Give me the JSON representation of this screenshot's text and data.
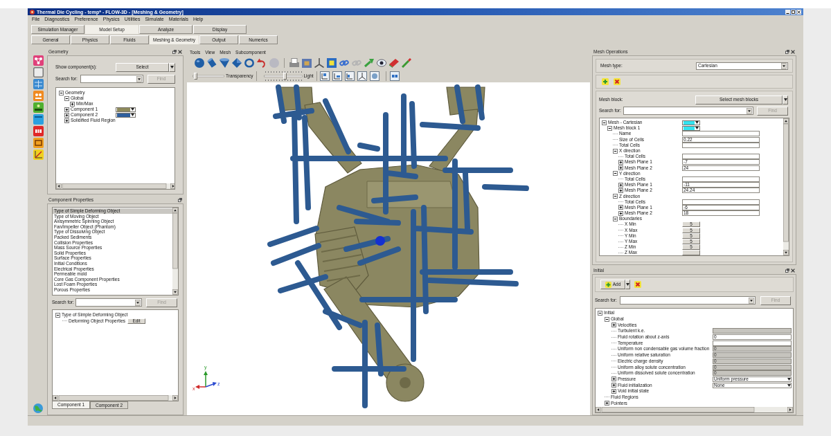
{
  "window": {
    "title": "Thermal Die Cycling - temp* - FLOW-3D - [Meshing & Geometry]"
  },
  "menu_bar": [
    "File",
    "Diagnostics",
    "Preference",
    "Physics",
    "Utilities",
    "Simulate",
    "Materials",
    "Help"
  ],
  "main_tabs": [
    {
      "label": "Simulation Manager",
      "selected": false
    },
    {
      "label": "Model Setup",
      "selected": true
    },
    {
      "label": "Analyze",
      "selected": false
    },
    {
      "label": "Display",
      "selected": false
    }
  ],
  "sub_tabs": [
    {
      "label": "General",
      "selected": false
    },
    {
      "label": "Physics",
      "selected": false
    },
    {
      "label": "Fluids",
      "selected": false
    },
    {
      "label": "Meshing & Geometry",
      "selected": true
    },
    {
      "label": "Output",
      "selected": false
    },
    {
      "label": "Numerics",
      "selected": false
    }
  ],
  "geometry": {
    "title": "Geometry",
    "show_label": "Show component(s):",
    "select_button": "Select",
    "search_label": "Search for:",
    "find_button": {
      "label": "Find",
      "disabled": true
    },
    "tree": [
      {
        "label": "Geometry",
        "expanded": true,
        "children": [
          {
            "label": "Global",
            "expanded": true,
            "children": [
              {
                "label": "Min/Max",
                "expanded": false
              }
            ]
          },
          {
            "label": "Component 1",
            "expanded": false,
            "kind": "swatch",
            "color": "#8e8a5c"
          },
          {
            "label": "Component 2",
            "expanded": false,
            "kind": "swatch",
            "color": "#2f5f9e"
          },
          {
            "label": "Solidified Fluid Region",
            "expanded": false
          }
        ]
      }
    ]
  },
  "component_properties": {
    "title": "Component Properties",
    "items": [
      {
        "label": "Type of Simple Deforming Object",
        "selected": true
      },
      {
        "label": "Type of Moving Object",
        "selected": false
      },
      {
        "label": "Axisymmetric Spinning Object",
        "selected": false
      },
      {
        "label": "Fan/Impeller Object (Phantom)",
        "selected": false
      },
      {
        "label": "Type of Dissolving Object",
        "selected": false
      },
      {
        "label": "Packed Sediments",
        "selected": false
      },
      {
        "label": "Collision Properties",
        "selected": false
      },
      {
        "label": "Mass Source Properties",
        "selected": false
      },
      {
        "label": "Solid Properties",
        "selected": false
      },
      {
        "label": "Surface Properties",
        "selected": false
      },
      {
        "label": "Initial Conditions",
        "selected": false
      },
      {
        "label": "Electrical Properties",
        "selected": false
      },
      {
        "label": "Permeable mold",
        "selected": false
      },
      {
        "label": "Core Gas Component Properties",
        "selected": false
      },
      {
        "label": "Lost Foam Properties",
        "selected": false
      },
      {
        "label": "Porous Properties",
        "selected": false
      }
    ],
    "search_label": "Search for:",
    "find_button": {
      "label": "Find",
      "disabled": true
    },
    "tree": [
      {
        "label": "Type of Simple Deforming Object",
        "expanded": true,
        "children": [
          {
            "label": "Deforming Object Properties",
            "kind": "button",
            "value": "Edit"
          }
        ]
      }
    ],
    "tabs": [
      {
        "label": "Component 1",
        "selected": true
      },
      {
        "label": "Component 2",
        "selected": false
      }
    ]
  },
  "viewport": {
    "menu": [
      "Tools",
      "View",
      "Mesh",
      "Subcomponent"
    ],
    "sliders": [
      {
        "label": "Transparency",
        "kind": "plain",
        "level": 0.04
      },
      {
        "label": "Light",
        "kind": "ticked",
        "level": 0.55
      }
    ],
    "axis_labels": [
      "y",
      "x",
      "z"
    ]
  },
  "mesh_operations": {
    "title": "Mesh Operations",
    "mesh_type_label": "Mesh type:",
    "mesh_type": "Cartesian",
    "mesh_block_label": "Mesh block:",
    "select_button": "Select mesh blocks",
    "search_label": "Search for:",
    "find_button": {
      "label": "Find",
      "disabled": true
    },
    "tree": [
      {
        "label": "Mesh - Cartesian",
        "expanded": true,
        "kind": "swatch",
        "color": "#33e3f0",
        "children": [
          {
            "label": "Mesh block 1",
            "expanded": true,
            "kind": "swatch",
            "color": "#33e3f0",
            "children": [
              {
                "label": "Name",
                "kind": "field",
                "disabled": false
              },
              {
                "label": "Size of Cells",
                "kind": "field",
                "disabled": false,
                "value": "0.22"
              },
              {
                "label": "Total Cells",
                "kind": "field",
                "disabled": false
              },
              {
                "label": "X direction",
                "expanded": true,
                "children": [
                  {
                    "label": "Total Cells",
                    "kind": "field",
                    "disabled": false
                  },
                  {
                    "label": "Mesh Plane 1",
                    "expanded": false,
                    "kind": "field",
                    "disabled": false,
                    "value": "-7"
                  },
                  {
                    "label": "Mesh Plane 2",
                    "expanded": false,
                    "kind": "field",
                    "disabled": false,
                    "value": "24"
                  }
                ]
              },
              {
                "label": "Y direction",
                "expanded": true,
                "children": [
                  {
                    "label": "Total Cells",
                    "kind": "field",
                    "disabled": false
                  },
                  {
                    "label": "Mesh Plane 1",
                    "expanded": false,
                    "kind": "field",
                    "disabled": false,
                    "value": "-11"
                  },
                  {
                    "label": "Mesh Plane 2",
                    "expanded": false,
                    "kind": "field",
                    "disabled": false,
                    "value": "24.24"
                  }
                ]
              },
              {
                "label": "Z direction",
                "expanded": true,
                "children": [
                  {
                    "label": "Total Cells",
                    "kind": "field",
                    "disabled": false
                  },
                  {
                    "label": "Mesh Plane 1",
                    "expanded": false,
                    "kind": "field",
                    "disabled": false,
                    "value": "-6"
                  },
                  {
                    "label": "Mesh Plane 2",
                    "expanded": false,
                    "kind": "field",
                    "disabled": false,
                    "value": "18"
                  }
                ]
              },
              {
                "label": "Boundaries",
                "expanded": true,
                "children": [
                  {
                    "label": "X Min",
                    "kind": "button",
                    "value": "5"
                  },
                  {
                    "label": "X Max",
                    "kind": "button",
                    "value": "5"
                  },
                  {
                    "label": "Y Min",
                    "kind": "button",
                    "value": "5"
                  },
                  {
                    "label": "Y Max",
                    "kind": "button",
                    "value": "5"
                  },
                  {
                    "label": "Z Min",
                    "kind": "button",
                    "value": "5"
                  },
                  {
                    "label": "Z Max",
                    "kind": "button"
                  }
                ]
              }
            ]
          }
        ]
      }
    ]
  },
  "initial": {
    "title": "Initial",
    "add_button": "Add",
    "search_label": "Search for:",
    "find_button": {
      "label": "Find",
      "disabled": true
    },
    "tree": [
      {
        "label": "Initial",
        "expanded": true,
        "children": [
          {
            "label": "Global",
            "expanded": true,
            "children": [
              {
                "label": "Velocities",
                "expanded": false
              },
              {
                "label": "Turbulent k.e.",
                "kind": "field",
                "disabled": true
              },
              {
                "label": "Fluid rotation about z-axis",
                "kind": "field",
                "disabled": false,
                "value": "0"
              },
              {
                "label": "Temperature",
                "kind": "field",
                "disabled": false
              },
              {
                "label": "Uniform non condensable gas volume fraction",
                "kind": "field",
                "disabled": true,
                "value": "0"
              },
              {
                "label": "Uniform relative saturation",
                "kind": "field",
                "disabled": true,
                "value": "0"
              },
              {
                "label": "Electric charge density",
                "kind": "field",
                "disabled": true,
                "value": "0"
              },
              {
                "label": "Uniform alloy solute concentration",
                "kind": "field",
                "disabled": true,
                "value": "0"
              },
              {
                "label": "Uniform dissolved solute concentration",
                "kind": "field",
                "disabled": true,
                "value": "0"
              },
              {
                "label": "Pressure",
                "expanded": false,
                "kind": "dropdown",
                "value": "Uniform pressure"
              },
              {
                "label": "Fluid initialization",
                "expanded": false,
                "kind": "dropdown",
                "value": "None"
              },
              {
                "label": "Void initial state",
                "expanded": false
              }
            ]
          },
          {
            "label": "Fluid Regions"
          },
          {
            "label": "Pointers",
            "expanded": false
          }
        ]
      }
    ]
  }
}
